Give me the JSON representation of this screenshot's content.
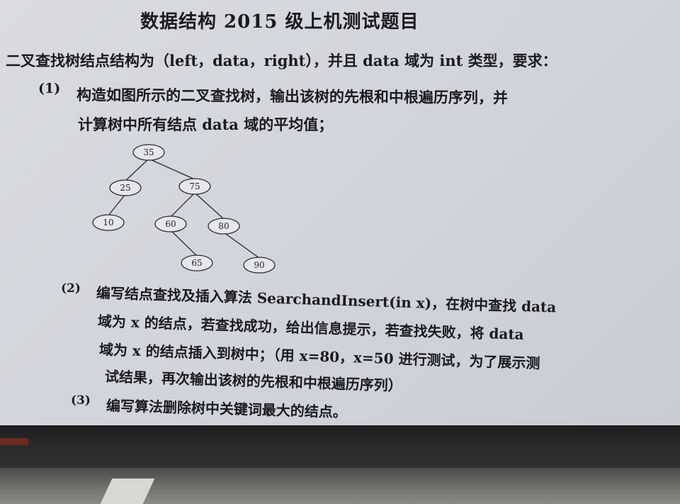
{
  "doc": {
    "title": "数据结构 2015 级上机测试题目",
    "intro": "二叉查找树结点结构为（left，data，right），并且 data 域为 int 类型，要求：",
    "q1": {
      "num": "(1)",
      "line1": "构造如图所示的二叉查找树，输出该树的先根和中根遍历序列，并",
      "line2": "计算树中所有结点 data 域的平均值；"
    },
    "tree": {
      "nodes": [
        {
          "id": "n35",
          "label": "35"
        },
        {
          "id": "n25",
          "label": "25"
        },
        {
          "id": "n75",
          "label": "75"
        },
        {
          "id": "n10",
          "label": "10"
        },
        {
          "id": "n60",
          "label": "60"
        },
        {
          "id": "n80",
          "label": "80"
        },
        {
          "id": "n65",
          "label": "65"
        },
        {
          "id": "n90",
          "label": "90"
        }
      ],
      "edges": [
        [
          "n35",
          "n25"
        ],
        [
          "n35",
          "n75"
        ],
        [
          "n25",
          "n10"
        ],
        [
          "n75",
          "n60"
        ],
        [
          "n75",
          "n80"
        ],
        [
          "n60",
          "n65"
        ],
        [
          "n80",
          "n90"
        ]
      ]
    },
    "q2": {
      "num": "(2)",
      "line1": "编写结点查找及插入算法 SearchandInsert(in x)，在树中查找 data",
      "line2": "域为 x 的结点，若查找成功，给出信息提示，若查找失败，将 data",
      "line3": "域为 x 的结点插入到树中；（用 x=80，x=50 进行测试，为了展示测",
      "line4": "试结果，再次输出该树的先根和中根遍历序列）"
    },
    "q3": {
      "num": "(3)",
      "line1": "编写算法删除树中关键词最大的结点。"
    }
  }
}
